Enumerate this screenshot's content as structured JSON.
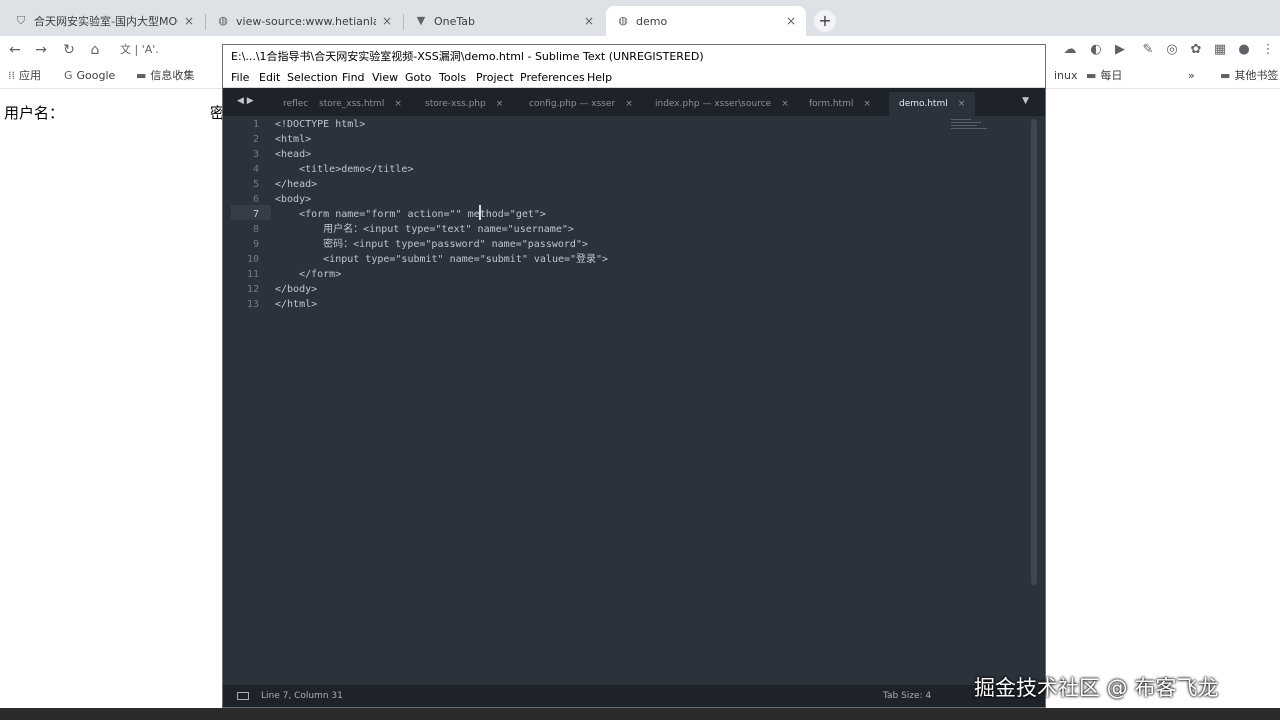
{
  "browser": {
    "tabs": [
      {
        "label": "合天网安实验室-国内大型MOOC",
        "favicon": "shield-icon",
        "active": false
      },
      {
        "label": "view-source:www.hetianlab.c",
        "favicon": "globe-icon",
        "active": false
      },
      {
        "label": "OneTab",
        "favicon": "funnel-icon",
        "active": false
      },
      {
        "label": "demo",
        "favicon": "globe-icon",
        "active": true
      }
    ],
    "new_tab": "+",
    "address_fragment": "文 | 'A'.",
    "bookmarks": [
      {
        "label": "应用",
        "icon": "apps-grid-icon"
      },
      {
        "label": "Google",
        "icon": "google-icon"
      },
      {
        "label": "信息收集",
        "icon": "folder-icon"
      },
      {
        "label": "inux",
        "icon": "folder-icon"
      },
      {
        "label": "每日",
        "icon": "folder-icon"
      },
      {
        "label": "其他书签",
        "icon": "folder-icon"
      }
    ]
  },
  "page": {
    "username_label": "用户名：",
    "password_fragment": "密"
  },
  "sublime": {
    "title": "E:\\...\\1合指导书\\合天网安实验室视频-XSS漏洞\\demo.html - Sublime Text (UNREGISTERED)",
    "menu": [
      "File",
      "Edit",
      "Selection",
      "Find",
      "View",
      "Goto",
      "Tools",
      "Project",
      "Preferences",
      "Help"
    ],
    "tabs": [
      {
        "label": "reflec",
        "close": ""
      },
      {
        "label": "store_xss.html",
        "close": "×"
      },
      {
        "label": "store-xss.php",
        "close": "×"
      },
      {
        "label": "config.php — xsser",
        "close": "×"
      },
      {
        "label": "index.php — xsser\\source",
        "close": "×"
      },
      {
        "label": "form.html",
        "close": "×"
      },
      {
        "label": "demo.html",
        "close": "×"
      }
    ],
    "active_tab": "demo.html",
    "lines": [
      "<!DOCTYPE html>",
      "<html>",
      "<head>",
      "    <title>demo</title>",
      "</head>",
      "<body>",
      "    <form name=\"form\" action=\"\" method=\"get\">",
      "        用户名：<input type=\"text\" name=\"username\">",
      "        密码：<input type=\"password\" name=\"password\">",
      "        <input type=\"submit\" name=\"submit\" value=\"登录\">",
      "    </form>",
      "</body>",
      "</html>"
    ],
    "line_numbers": [
      "1",
      "2",
      "3",
      "4",
      "5",
      "6",
      "7",
      "8",
      "9",
      "10",
      "11",
      "12",
      "13"
    ],
    "current_line": 7,
    "status": "Line 7, Column 31",
    "tab_size": "Tab Size: 4"
  },
  "watermark": "掘金技术社区 @ 布客飞龙"
}
